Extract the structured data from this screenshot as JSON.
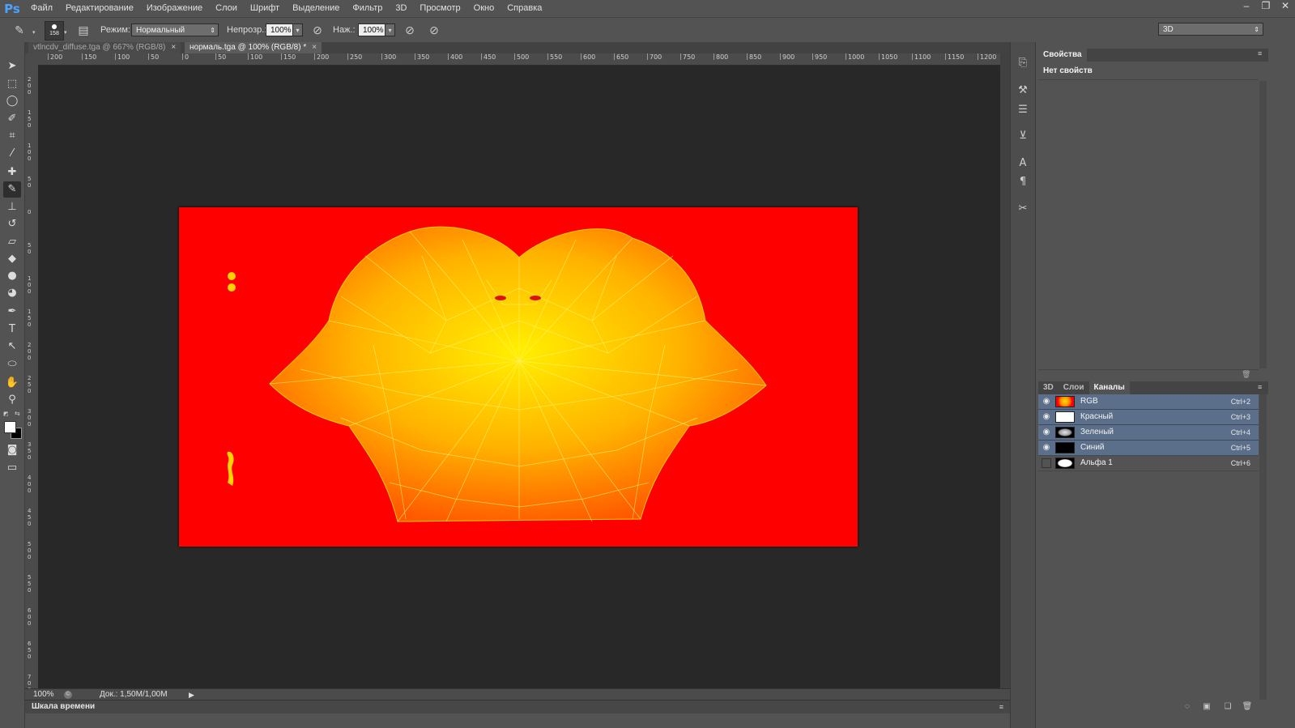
{
  "app": {
    "logo": "Ps"
  },
  "menu": [
    "Файл",
    "Редактирование",
    "Изображение",
    "Слои",
    "Шрифт",
    "Выделение",
    "Фильтр",
    "3D",
    "Просмотр",
    "Окно",
    "Справка"
  ],
  "window_controls": {
    "minimize": "–",
    "restore": "❐",
    "close": "✕"
  },
  "options": {
    "brush_size": "158",
    "mode_label": "Режим:",
    "mode_value": "Нормальный",
    "opacity_label": "Непрозр.:",
    "opacity_value": "100%",
    "flow_label": "Наж.:",
    "flow_value": "100%",
    "workspace": "3D"
  },
  "tabs": [
    {
      "label": "vtlncdv_diffuse.tga @ 667% (RGB/8)",
      "close": "×",
      "active": false
    },
    {
      "label": "нормаль.tga @ 100% (RGB/8) *",
      "close": "×",
      "active": true
    }
  ],
  "ruler_top": [
    "200",
    "150",
    "100",
    "50",
    "0",
    "50",
    "100",
    "150",
    "200",
    "250",
    "300",
    "350",
    "400",
    "450",
    "500",
    "550",
    "600",
    "650",
    "700",
    "750",
    "800",
    "850",
    "900",
    "950",
    "1000",
    "1050",
    "1100",
    "1150",
    "1200"
  ],
  "ruler_left": [
    "200",
    "150",
    "100",
    "50",
    "0",
    "50",
    "100",
    "150",
    "200",
    "250",
    "300",
    "350",
    "400",
    "450",
    "500",
    "550",
    "600",
    "650",
    "700"
  ],
  "status": {
    "zoom": "100%",
    "doc": "Док.: 1,50M/1,00M",
    "timeline": "Шкала времени"
  },
  "properties": {
    "tab": "Свойства",
    "empty": "Нет свойств"
  },
  "panel_tabs": [
    {
      "label": "3D",
      "active": false
    },
    {
      "label": "Слои",
      "active": false
    },
    {
      "label": "Каналы",
      "active": true
    }
  ],
  "channels": [
    {
      "name": "RGB",
      "shortcut": "Ctrl+2",
      "visible": true
    },
    {
      "name": "Красный",
      "shortcut": "Ctrl+3",
      "visible": true
    },
    {
      "name": "Зеленый",
      "shortcut": "Ctrl+4",
      "visible": true
    },
    {
      "name": "Синий",
      "shortcut": "Ctrl+5",
      "visible": true
    },
    {
      "name": "Альфа 1",
      "shortcut": "Ctrl+6",
      "visible": false
    }
  ],
  "colors": {
    "canvas_bg": "#282828",
    "artwork_bg": "#ff0000",
    "mesh_outer": "#ff6a00",
    "mesh_inner": "#ffe800",
    "selection": "#5b6f8a"
  }
}
